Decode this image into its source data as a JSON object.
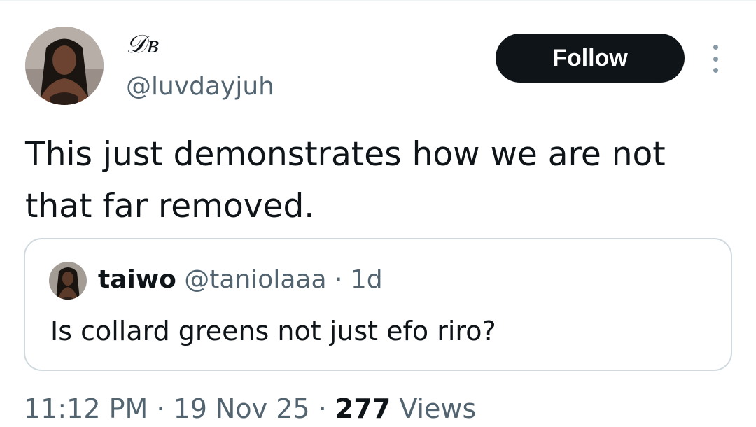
{
  "author": {
    "display_name": "𝒟ᏼ",
    "handle": "@luvdayjuh"
  },
  "actions": {
    "follow_label": "Follow",
    "more_icon": "more-vertical-icon"
  },
  "tweet": {
    "text": "This just demonstrates how we are not that far removed."
  },
  "quoted_tweet": {
    "display_name": "taiwo",
    "handle": "@taniolaaa",
    "separator": "·",
    "time": "1d",
    "text": "Is collard greens not just efo riro?"
  },
  "meta": {
    "time": "11:12 PM",
    "sep1": "·",
    "date": "19 Nov 25",
    "sep2": "·",
    "views_count": "277",
    "views_label": "Views"
  },
  "colors": {
    "text_primary": "#0f1419",
    "text_secondary": "#536471",
    "border": "#cfd9de",
    "follow_bg": "#0f1419"
  }
}
